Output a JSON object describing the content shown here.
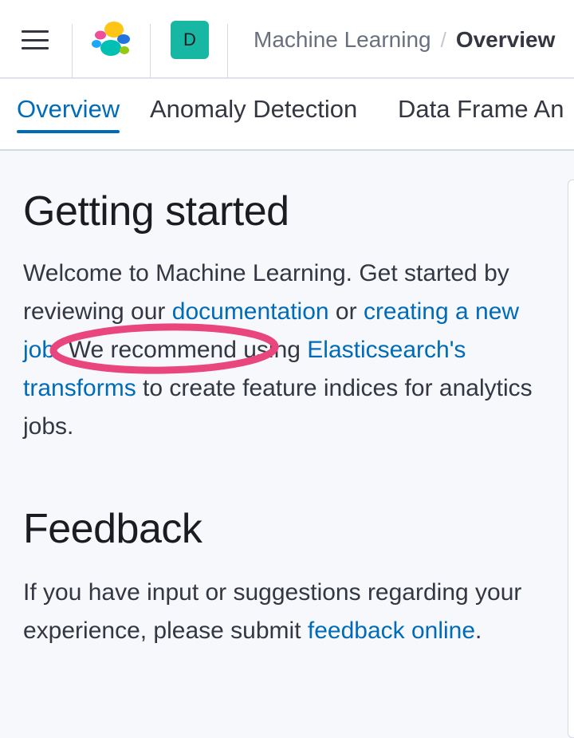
{
  "header": {
    "space_initial": "D",
    "breadcrumbs": {
      "parent": "Machine Learning",
      "separator": "/",
      "current": "Overview"
    }
  },
  "tabs": [
    {
      "label": "Overview",
      "active": true
    },
    {
      "label": "Anomaly Detection",
      "active": false
    },
    {
      "label": "Data Frame An",
      "active": false
    }
  ],
  "getting_started": {
    "title": "Getting started",
    "text_1": "Welcome to Machine Learning. Get started by reviewing our ",
    "link_documentation": "documentation",
    "text_2": " or ",
    "link_new_job": "creating a new job",
    "text_3": ". We recommend using ",
    "link_transforms": "Elasticsearch's transforms",
    "text_4": " to create feature indices for analytics jobs."
  },
  "feedback": {
    "title": "Feedback",
    "text_1": "If you have input or suggestions regarding your experience, please submit ",
    "link_feedback": "feedback online",
    "text_2": "."
  },
  "colors": {
    "link": "#006bb8",
    "annotation": "#e8467c",
    "space_avatar": "#17b7a4"
  }
}
